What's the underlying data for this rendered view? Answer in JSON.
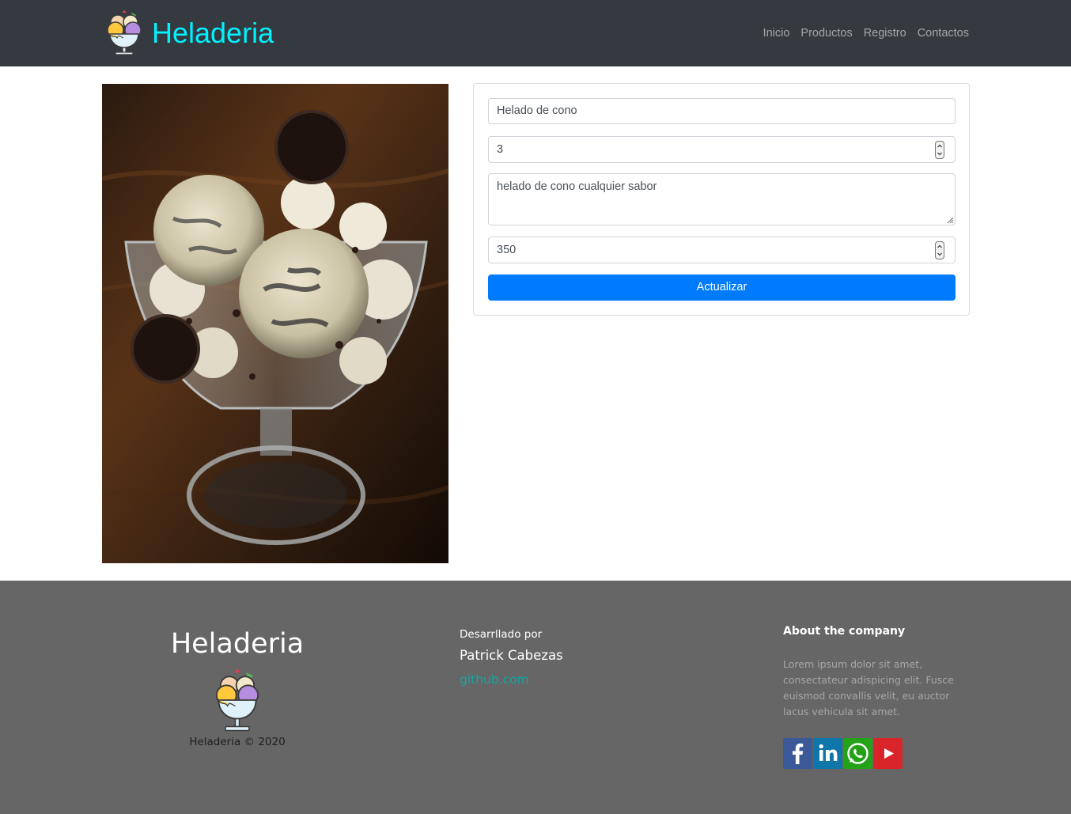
{
  "navbar": {
    "brand": "Heladeria",
    "links": [
      "Inicio",
      "Productos",
      "Registro",
      "Contactos"
    ]
  },
  "form": {
    "name": "Helado de cono",
    "quantity": "3",
    "description": "helado de cono cualquier sabor",
    "price": "350",
    "submit_label": "Actualizar"
  },
  "footer": {
    "brand": "Heladeria",
    "copyright": "Heladeria © 2020",
    "dev_label": "Desarrllado por",
    "dev_name": "Patrick Cabezas",
    "dev_link": "github.com",
    "about_title": "About the company",
    "about_text": "Lorem ipsum dolor sit amet, consectateur adispicing elit. Fusce euismod convallis velit, eu auctor lacus vehicula sit amet.",
    "social": [
      "facebook-icon",
      "linkedin-icon",
      "whatsapp-icon",
      "youtube-icon"
    ]
  },
  "colors": {
    "navbar_bg": "#343a40",
    "brand_text": "#00f2ff",
    "primary_button": "#007bff",
    "footer_bg": "#666666",
    "footer_link": "#13a7a0"
  }
}
